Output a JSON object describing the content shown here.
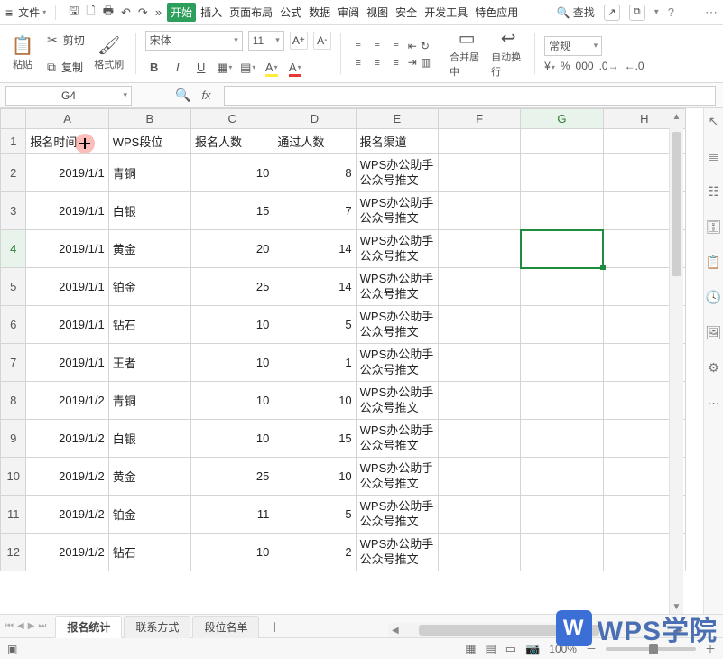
{
  "titlebar": {
    "file_label": "文件",
    "search_label": "查找",
    "tabs": [
      "开始",
      "插入",
      "页面布局",
      "公式",
      "数据",
      "审阅",
      "视图",
      "安全",
      "开发工具",
      "特色应用"
    ],
    "active_tab_index": 0
  },
  "ribbon": {
    "paste_label": "粘贴",
    "cut_label": "剪切",
    "copy_label": "复制",
    "format_painter_label": "格式刷",
    "font_name": "宋体",
    "font_size": "11",
    "merge_label": "合并居中",
    "wrap_label": "自动换行",
    "style_select": "常规"
  },
  "namebox": {
    "cell_ref": "G4",
    "fx_label": "fx"
  },
  "columns": [
    "A",
    "B",
    "C",
    "D",
    "E",
    "F",
    "G",
    "H"
  ],
  "header_row": [
    "报名时间",
    "WPS段位",
    "报名人数",
    "通过人数",
    "报名渠道",
    "",
    "",
    ""
  ],
  "rows": [
    {
      "n": 2,
      "a": "2019/1/1",
      "b": "青铜",
      "c": "10",
      "d": "8",
      "e": "WPS办公助手公众号推文"
    },
    {
      "n": 3,
      "a": "2019/1/1",
      "b": "白银",
      "c": "15",
      "d": "7",
      "e": "WPS办公助手公众号推文"
    },
    {
      "n": 4,
      "a": "2019/1/1",
      "b": "黄金",
      "c": "20",
      "d": "14",
      "e": "WPS办公助手公众号推文"
    },
    {
      "n": 5,
      "a": "2019/1/1",
      "b": "铂金",
      "c": "25",
      "d": "14",
      "e": "WPS办公助手公众号推文"
    },
    {
      "n": 6,
      "a": "2019/1/1",
      "b": "钻石",
      "c": "10",
      "d": "5",
      "e": "WPS办公助手公众号推文"
    },
    {
      "n": 7,
      "a": "2019/1/1",
      "b": "王者",
      "c": "10",
      "d": "1",
      "e": "WPS办公助手公众号推文"
    },
    {
      "n": 8,
      "a": "2019/1/2",
      "b": "青铜",
      "c": "10",
      "d": "10",
      "e": "WPS办公助手公众号推文"
    },
    {
      "n": 9,
      "a": "2019/1/2",
      "b": "白银",
      "c": "10",
      "d": "15",
      "e": "WPS办公助手公众号推文"
    },
    {
      "n": 10,
      "a": "2019/1/2",
      "b": "黄金",
      "c": "25",
      "d": "10",
      "e": "WPS办公助手公众号推文"
    },
    {
      "n": 11,
      "a": "2019/1/2",
      "b": "铂金",
      "c": "11",
      "d": "5",
      "e": "WPS办公助手公众号推文"
    },
    {
      "n": 12,
      "a": "2019/1/2",
      "b": "钻石",
      "c": "10",
      "d": "2",
      "e": "WPS办公助手公众号推文"
    }
  ],
  "selected": {
    "col_index": 6,
    "row_number": 4
  },
  "sheets": {
    "tabs": [
      "报名统计",
      "联系方式",
      "段位名单"
    ],
    "active_index": 0
  },
  "status": {
    "zoom": "100%"
  },
  "branding": {
    "logo_text": "WPS学院",
    "logo_mark": "W"
  }
}
